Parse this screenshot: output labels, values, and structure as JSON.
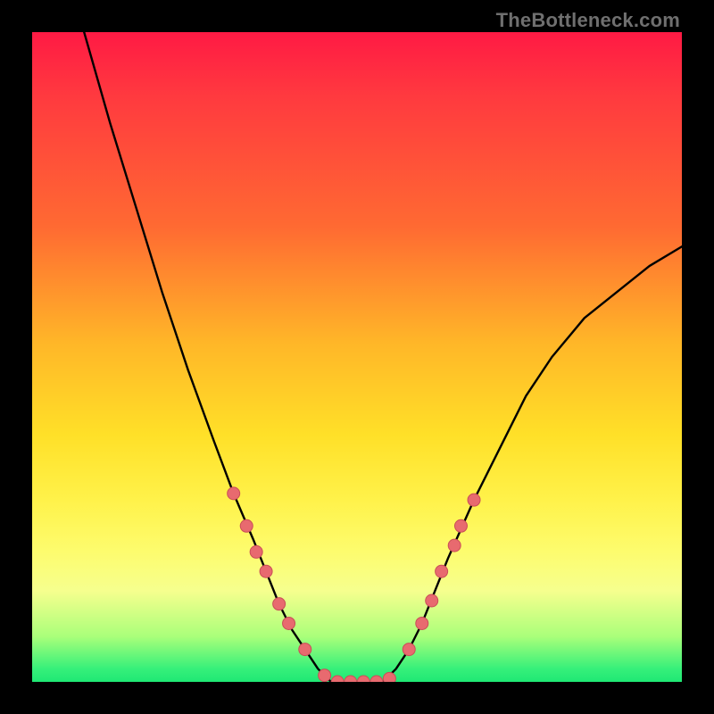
{
  "watermark": {
    "text": "TheBottleneck.com"
  },
  "colors": {
    "frame_bg": "#000000",
    "curve_stroke": "#000000",
    "marker_fill": "#e86a6f",
    "marker_stroke": "#c94e57",
    "watermark": "#6f6f6f"
  },
  "chart_data": {
    "type": "line",
    "title": "",
    "xlabel": "",
    "ylabel": "",
    "xlim": [
      0,
      100
    ],
    "ylim": [
      0,
      100
    ],
    "grid": false,
    "legend_position": "none",
    "series": [
      {
        "name": "bottleneck-curve",
        "x": [
          8,
          12,
          16,
          20,
          24,
          28,
          31,
          34,
          36,
          38,
          40,
          42,
          44,
          46,
          48,
          50,
          52,
          54,
          56,
          58,
          60,
          62,
          64,
          68,
          72,
          76,
          80,
          85,
          90,
          95,
          100
        ],
        "y": [
          100,
          86,
          73,
          60,
          48,
          37,
          29,
          22,
          17,
          12,
          8,
          5,
          2,
          0,
          0,
          0,
          0,
          0,
          2,
          5,
          9,
          14,
          19,
          28,
          36,
          44,
          50,
          56,
          60,
          64,
          67
        ]
      }
    ],
    "annotations": {
      "marker_points": [
        {
          "x": 31,
          "y": 29
        },
        {
          "x": 33,
          "y": 24
        },
        {
          "x": 34.5,
          "y": 20
        },
        {
          "x": 36,
          "y": 17
        },
        {
          "x": 38,
          "y": 12
        },
        {
          "x": 39.5,
          "y": 9
        },
        {
          "x": 42,
          "y": 5
        },
        {
          "x": 45,
          "y": 1
        },
        {
          "x": 47,
          "y": 0
        },
        {
          "x": 49,
          "y": 0
        },
        {
          "x": 51,
          "y": 0
        },
        {
          "x": 53,
          "y": 0
        },
        {
          "x": 55,
          "y": 0.5
        },
        {
          "x": 58,
          "y": 5
        },
        {
          "x": 60,
          "y": 9
        },
        {
          "x": 61.5,
          "y": 12.5
        },
        {
          "x": 63,
          "y": 17
        },
        {
          "x": 65,
          "y": 21
        },
        {
          "x": 66,
          "y": 24
        },
        {
          "x": 68,
          "y": 28
        }
      ]
    }
  }
}
